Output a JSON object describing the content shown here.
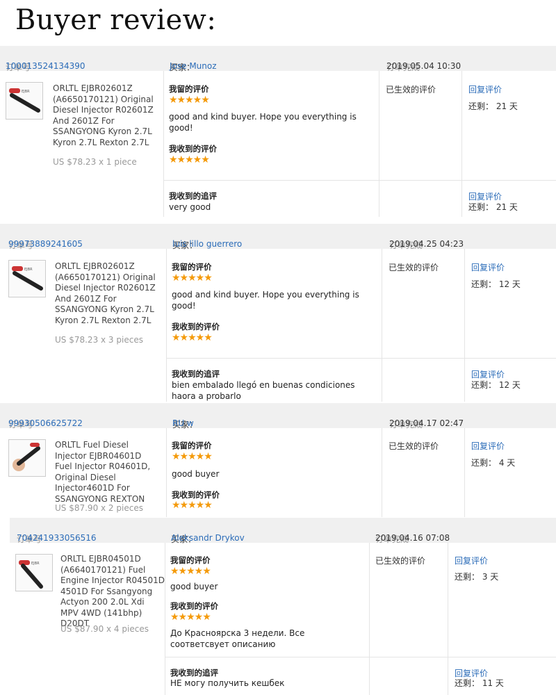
{
  "page_title": "Buyer review:",
  "labels": {
    "order_no": "订单号",
    "buyer": "买家：",
    "order_done": "订单完成",
    "left_review": "我留的评价",
    "received_review": "我收到的评价",
    "received_followup": "我收到的追评",
    "effective": "已生效的评价",
    "reply": "回复评价",
    "remaining": "还剩："
  },
  "orders": [
    {
      "order_id": "100013524134390",
      "buyer": "Jose Munoz",
      "completed": "2019.05.04 10:30",
      "product": "ORLTL EJBR02601Z (A6650170121) Original Diesel Injector R02601Z And 2601Z For SSANGYONG Kyron 2.7L Kyron 2.7L Rexton 2.7L",
      "price": "US $78.23 x 1 piece",
      "left_stars": "★★★★★",
      "left_text": "good and kind buyer. Hope you everything is good!",
      "received_stars": "★★★★★",
      "remaining_days": "21 天",
      "followup_text": "very good",
      "followup_remaining": "21 天"
    },
    {
      "order_id": "99973889241605",
      "buyer": "luis lillo guerrero",
      "completed": "2019.04.25 04:23",
      "product": "ORLTL EJBR02601Z (A6650170121) Original Diesel Injector R02601Z And 2601Z For SSANGYONG Kyron 2.7L Kyron 2.7L Rexton 2.7L",
      "price": "US $78.23 x 3 pieces",
      "left_stars": "★★★★★",
      "left_text": "good and kind buyer. Hope you everything is good!",
      "received_stars": "★★★★★",
      "remaining_days": "12 天",
      "followup_text": "bien embalado llegó en buenas condiciones haora a probarlo",
      "followup_remaining": "12 天"
    },
    {
      "order_id": "99930506625722",
      "buyer": "RU w",
      "completed": "2019.04.17 02:47",
      "product": "ORLTL Fuel Diesel Injector EJBR04601D Fuel Injector R04601D, Original Diesel Injector4601D For SSANGYONG REXTON",
      "price": "US $87.90 x 2 pieces",
      "left_stars": "★★★★★",
      "left_text": "good buyer",
      "received_stars": "★★★★★",
      "remaining_days": "4 天"
    },
    {
      "order_id": "704241933056516",
      "buyer": "Aleksandr Drykov",
      "completed": "2019.04.16 07:08",
      "product": "ORLTL EJBR04501D (A6640170121) Fuel Engine Injector R04501D 4501D For Ssangyong Actyon 200 2.0L Xdi MPV 4WD (141bhp) D20DT",
      "price": "US $87.90 x 4 pieces",
      "left_stars": "★★★★★",
      "left_text": "good buyer",
      "received_stars": "★★★★★",
      "received_text": "До Красноярска 3 недели. Все соответсвует описанию",
      "remaining_days": "3 天",
      "followup_text": "НЕ могу получить кешбек",
      "followup_remaining": "11 天"
    }
  ],
  "colors": {
    "link": "#2b6cb8",
    "star": "#f49a0a",
    "header_bg": "#f0f0f0"
  },
  "icons": {
    "thumbnail": "injector-thumbnail-icon",
    "star": "star-icon"
  }
}
